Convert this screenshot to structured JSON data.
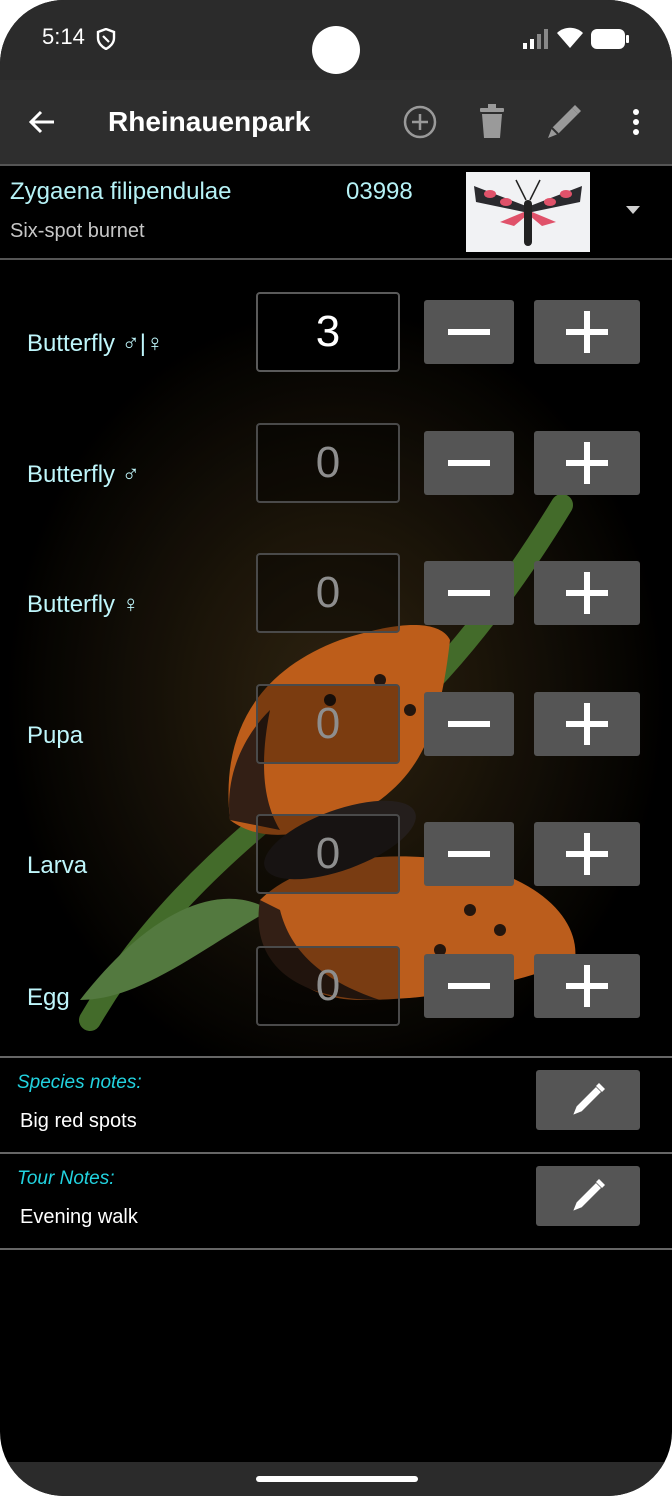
{
  "status_bar": {
    "time": "5:14",
    "icons": [
      "shield-icon",
      "signal-icon",
      "wifi-icon",
      "battery-icon"
    ]
  },
  "app_bar": {
    "title": "Rheinauenpark",
    "icons": [
      "back-arrow-icon",
      "add-circle-icon",
      "trash-icon",
      "pencil-icon",
      "more-vert-icon"
    ]
  },
  "species": {
    "scientific_name": "Zygaena filipendulae",
    "code": "03998",
    "common_name": "Six-spot burnet"
  },
  "counters": [
    {
      "label": "Butterfly ♂|♀",
      "value": "3",
      "active": true
    },
    {
      "label": "Butterfly ♂",
      "value": "0",
      "active": false
    },
    {
      "label": "Butterfly ♀",
      "value": "0",
      "active": false
    },
    {
      "label": "Pupa",
      "value": "0",
      "active": false
    },
    {
      "label": "Larva",
      "value": "0",
      "active": false
    },
    {
      "label": "Egg",
      "value": "0",
      "active": false
    }
  ],
  "notes": {
    "species": {
      "title": "Species notes:",
      "text": "Big red spots"
    },
    "tour": {
      "title": "Tour Notes:",
      "text": "Evening walk"
    }
  },
  "colors": {
    "label_cyan": "#bff6fb",
    "note_title_cyan": "#22d3e0",
    "button_gray": "#555555",
    "app_bar": "#2e2e2e"
  }
}
